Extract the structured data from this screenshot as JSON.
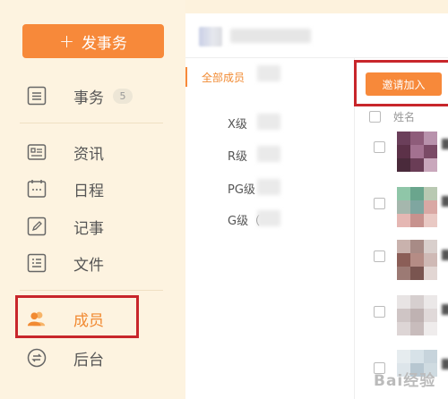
{
  "sidebar": {
    "new_button": {
      "plus": "+",
      "label": "发事务"
    },
    "items": [
      {
        "label": "事务",
        "badge": "5",
        "icon": "list-icon"
      },
      {
        "label": "资讯",
        "icon": "news-icon"
      },
      {
        "label": "日程",
        "icon": "calendar-icon"
      },
      {
        "label": "记事",
        "icon": "edit-note-icon"
      },
      {
        "label": "文件",
        "icon": "file-icon"
      },
      {
        "label": "成员",
        "icon": "members-icon"
      },
      {
        "label": "后台",
        "icon": "sync-icon"
      }
    ]
  },
  "main": {
    "groups": {
      "all": "全部成员",
      "items": [
        "X级",
        "R级",
        "PG级",
        "G级（"
      ]
    },
    "invite_button": "邀请加入",
    "table": {
      "name_header": "姓名"
    },
    "watermark": "Bai经验"
  },
  "colors": {
    "accent": "#f7893a",
    "highlight": "#c8262b",
    "sidebar_bg": "#fdf3e0"
  }
}
